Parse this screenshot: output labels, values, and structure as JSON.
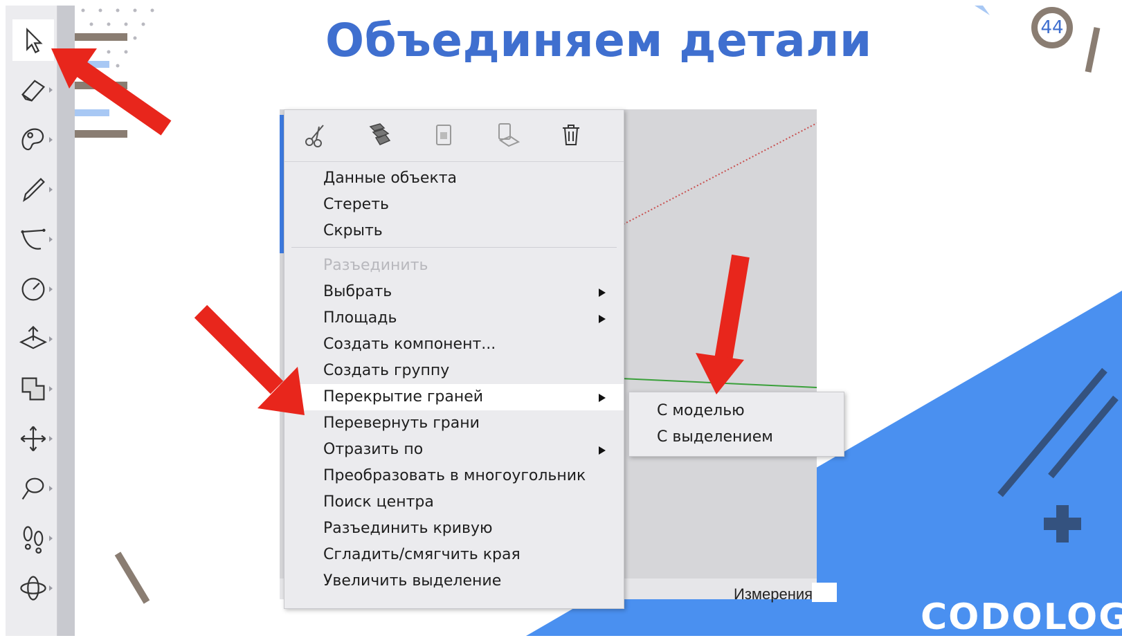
{
  "slide": {
    "title": "Объединяем детали",
    "page_number": "44"
  },
  "toolbar": {
    "tools": [
      {
        "name": "select-tool",
        "icon": "cursor-arrow-icon",
        "active": true
      },
      {
        "name": "eraser-tool",
        "icon": "eraser-icon"
      },
      {
        "name": "paint-bucket-tool",
        "icon": "paint-icon"
      },
      {
        "name": "line-tool",
        "icon": "pencil-icon"
      },
      {
        "name": "arc-tool",
        "icon": "arc-icon"
      },
      {
        "name": "circle-tool",
        "icon": "circle-icon"
      },
      {
        "name": "push-pull-tool",
        "icon": "push-pull-icon"
      },
      {
        "name": "offset-tool",
        "icon": "offset-icon"
      },
      {
        "name": "move-tool",
        "icon": "move-icon"
      },
      {
        "name": "tape-measure-tool",
        "icon": "tape-measure-icon"
      },
      {
        "name": "walk-tool",
        "icon": "footprints-icon"
      },
      {
        "name": "orbit-tool",
        "icon": "orbit-icon"
      }
    ]
  },
  "context_menu": {
    "icons": [
      "cut-icon",
      "copy-icon",
      "paste-icon",
      "paste-in-place-icon",
      "delete-icon"
    ],
    "items": [
      {
        "label": "Данные объекта"
      },
      {
        "label": "Стереть"
      },
      {
        "label": "Скрыть"
      },
      {
        "label": "Разъединить",
        "disabled": true
      },
      {
        "label": "Выбрать",
        "submenu": true
      },
      {
        "label": "Площадь",
        "submenu": true
      },
      {
        "label": "Создать компонент..."
      },
      {
        "label": "Создать группу"
      },
      {
        "label": "Перекрытие граней",
        "submenu": true,
        "highlighted": true
      },
      {
        "label": "Перевернуть грани"
      },
      {
        "label": "Отразить по",
        "submenu": true
      },
      {
        "label": "Преобразовать в многоугольник"
      },
      {
        "label": "Поиск центра"
      },
      {
        "label": "Разъединить кривую"
      },
      {
        "label": "Сгладить/смягчить края"
      },
      {
        "label": "Увеличить выделение"
      }
    ]
  },
  "submenu": {
    "items": [
      {
        "label": "С моделью"
      },
      {
        "label": "С выделением"
      }
    ]
  },
  "statusbar": {
    "measure_label": "Измерения"
  },
  "logo": {
    "text": "CODOLOGIA"
  },
  "colors": {
    "title": "#3f6fcf",
    "accent_blue": "#4a90f0",
    "arrow_red": "#e8261c",
    "menu_bg": "#ebebee"
  }
}
